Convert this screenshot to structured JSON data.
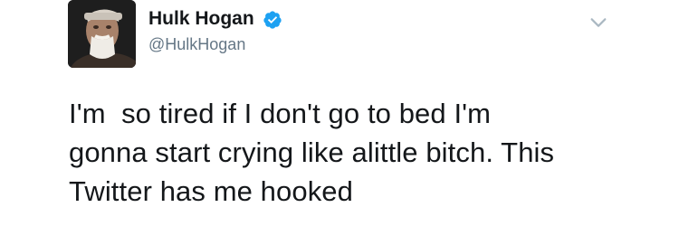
{
  "tweet": {
    "display_name": "Hulk Hogan",
    "handle": "@HulkHogan",
    "verified": true,
    "avatar_icon": "profile-photo",
    "menu_icon": "chevron-down-icon",
    "text": "I'm  so tired if I don't go to bed I'm\ngonna start crying like alittle bitch. This\nTwitter has me hooked"
  },
  "colors": {
    "verified_blue": "#1da1f2",
    "handle_gray": "#657786",
    "chevron_gray": "#aab8c2",
    "text": "#14171a"
  }
}
